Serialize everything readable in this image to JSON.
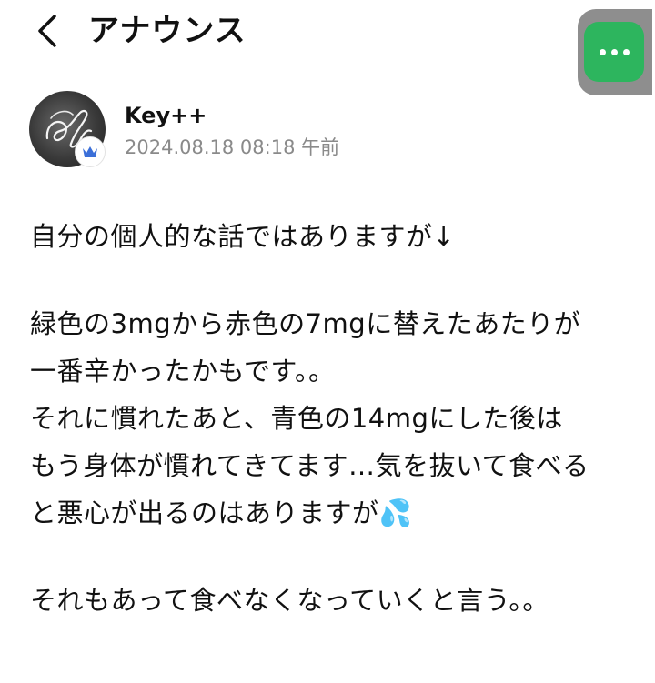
{
  "header": {
    "title": "アナウンス",
    "back_icon": "chevron-left-icon",
    "more_icon": "more-horizontal-icon",
    "more_color": "#2db55e"
  },
  "author": {
    "name": "Key++",
    "date": "2024.08.18 08:18 午前",
    "badge_icon": "crown-icon",
    "badge_color": "#3b6fd8"
  },
  "body": {
    "lines": [
      "自分の個人的な話ではありますが↓",
      "",
      "緑色の3mgから赤色の7mgに替えたあたりが",
      "一番辛かったかもです。。",
      "それに慣れたあと、青色の14mgにした後は",
      "もう身体が慣れてきてます…気を抜いて食べる",
      "と悪心が出るのはありますが💦",
      "",
      "それもあって食べなくなっていくと言う。。"
    ]
  }
}
